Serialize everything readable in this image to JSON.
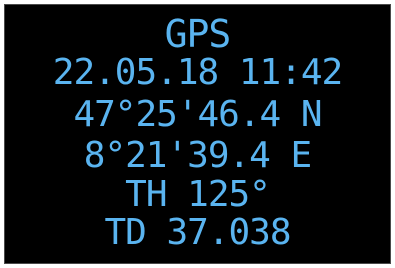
{
  "screen": {
    "text_color": "#5ab4f0",
    "background_color": "#000000",
    "lines": [
      "GPS",
      "22.05.18 11:42",
      "47°25'46.4 N",
      "8°21'39.4 E",
      "TH 125°",
      "TD 37.038"
    ]
  }
}
